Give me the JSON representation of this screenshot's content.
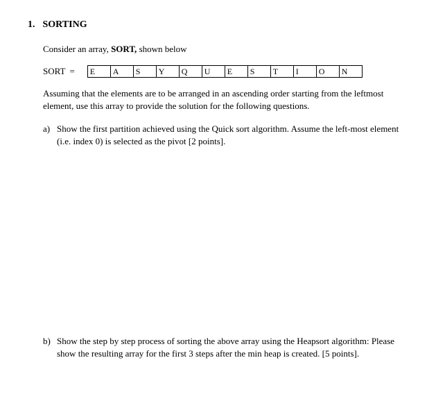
{
  "section": {
    "number": "1.",
    "title": "SORTING"
  },
  "intro": {
    "prefix": "Consider an array, ",
    "array_name": "SORT,",
    "suffix": " shown below"
  },
  "array": {
    "label": "SORT",
    "eq": "=",
    "cells": [
      "E",
      "A",
      "S",
      "Y",
      "Q",
      "U",
      "E",
      "S",
      "T",
      "I",
      "O",
      "N"
    ]
  },
  "assume": "Assuming that the elements are to be arranged in an ascending order starting from the leftmost element, use this array to provide the solution for the following questions.",
  "qa": {
    "marker": "a)",
    "text": "Show the first partition achieved using the Quick sort algorithm. Assume the left-most element (i.e. index 0) is selected as the pivot [2 points]."
  },
  "qb": {
    "marker": "b)",
    "text": "Show the step by step process of sorting the above array using the Heapsort algorithm: Please show the resulting array for the first 3 steps after the min heap is created. [5 points]."
  }
}
